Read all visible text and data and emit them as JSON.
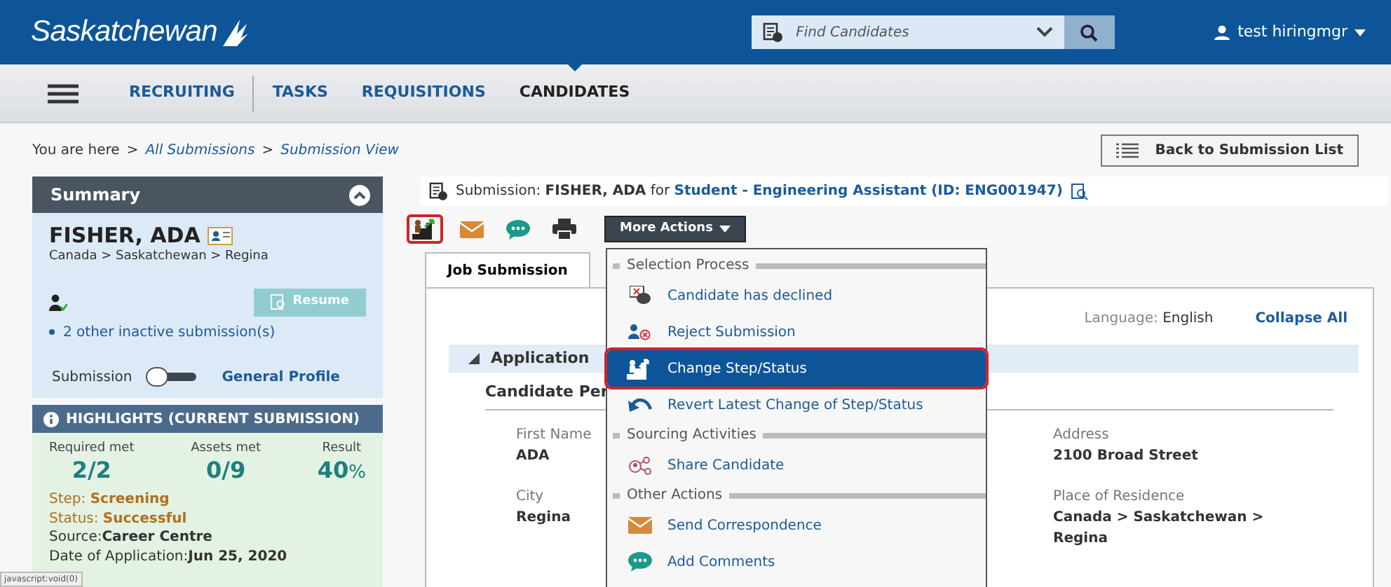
{
  "header": {
    "logo": "Saskatchewan",
    "search": {
      "placeholder": "Find Candidates"
    },
    "user": "test hiringmgr"
  },
  "nav": [
    {
      "label": "RECRUITING",
      "selected": false
    },
    {
      "label": "TASKS",
      "selected": false
    },
    {
      "label": "REQUISITIONS",
      "selected": false
    },
    {
      "label": "CANDIDATES",
      "selected": true
    }
  ],
  "breadcrumb": {
    "prefix": "You are here",
    "separator": ">",
    "links": [
      "All Submissions",
      "Submission View"
    ]
  },
  "back_button": "Back to Submission List",
  "summary": {
    "title": "Summary",
    "expanded": true,
    "name": "FISHER, ADA",
    "location": "Canada > Saskatchewan > Regina",
    "resume_button": {
      "label": "Resume",
      "disabled": true
    },
    "inactive_link": "2 other inactive submission(s)",
    "toggle": {
      "left": "Submission",
      "right": "General Profile",
      "on": false
    },
    "highlights": {
      "title": "HIGHLIGHTS (CURRENT SUBMISSION)",
      "metrics": [
        {
          "label": "Required met",
          "value": "2/2"
        },
        {
          "label": "Assets met",
          "value": "0/9"
        },
        {
          "label": "Result",
          "value": "40",
          "unit": "%"
        }
      ],
      "facts": [
        {
          "label": "Step: ",
          "value": "Screening",
          "kind": "status"
        },
        {
          "label": "Status: ",
          "value": "Successful",
          "kind": "status"
        },
        {
          "label": "Source:",
          "value": "Career Centre",
          "kind": "info"
        },
        {
          "label": "Date of Application:",
          "value": "Jun 25, 2020",
          "kind": "info"
        }
      ]
    }
  },
  "submission": {
    "prefix": "Submission:",
    "candidate": "FISHER, ADA",
    "joiner": "for",
    "job": "Student - Engineering Assistant",
    "id": "(ID: ENG001947)"
  },
  "action_icons": [
    {
      "kind": "step",
      "highlighted": true
    },
    {
      "kind": "mail",
      "highlighted": false
    },
    {
      "kind": "comment",
      "highlighted": false
    },
    {
      "kind": "print",
      "highlighted": false
    }
  ],
  "more_actions": {
    "label": "More Actions",
    "expanded": true,
    "groups": [
      {
        "title": "Selection Process",
        "items": [
          {
            "label": "Candidate has declined",
            "kind": "declined",
            "selected": false,
            "highlighted": false
          },
          {
            "label": "Reject Submission",
            "kind": "reject",
            "selected": false,
            "highlighted": false
          },
          {
            "label": "Change Step/Status",
            "kind": "step",
            "selected": true,
            "highlighted": true
          },
          {
            "label": "Revert Latest Change of Step/Status",
            "kind": "revert",
            "selected": false,
            "highlighted": false
          }
        ]
      },
      {
        "title": "Sourcing Activities",
        "items": [
          {
            "label": "Share Candidate",
            "kind": "share",
            "selected": false,
            "highlighted": false
          }
        ]
      },
      {
        "title": "Other Actions",
        "items": [
          {
            "label": "Send Correspondence",
            "kind": "mail",
            "selected": false,
            "highlighted": false
          },
          {
            "label": "Add Comments",
            "kind": "comment",
            "selected": false,
            "highlighted": false
          }
        ]
      }
    ]
  },
  "tabs": [
    {
      "label": "Job Submission",
      "selected": true
    }
  ],
  "language": {
    "label": "Language:",
    "value": "English"
  },
  "collapse_all": "Collapse All",
  "section": {
    "title": "Application",
    "expanded": true,
    "subsection": "Candidate Per",
    "fields": [
      {
        "label": "First Name",
        "value": "ADA"
      },
      {
        "label": "Address",
        "value": "2100 Broad Street"
      },
      {
        "label": "City",
        "value": "Regina"
      },
      {
        "label": "Place of Residence",
        "value": "Canada > Saskatchewan > Regina"
      }
    ]
  },
  "status_bar": "javascript:void(0)"
}
